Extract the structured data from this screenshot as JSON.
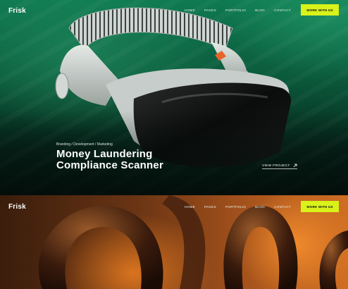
{
  "brand": {
    "logo": "Frisk"
  },
  "nav": {
    "items": [
      "HOME",
      "PAGES",
      "PORTFOLIO",
      "BLOG",
      "CONTACT"
    ],
    "cta_label": "WORK WITH US"
  },
  "hero": {
    "tags": "Branding / Development / Marketing",
    "title_line1": "Money Laundering",
    "title_line2": "Compliance Scanner",
    "view_label": "VIEW PROJECT",
    "view_icon": "arrow-up-right-icon"
  },
  "colors": {
    "accent": "#d8f21a",
    "hero_green": "#0b5a3c",
    "hero_orange": "#d06e22"
  }
}
